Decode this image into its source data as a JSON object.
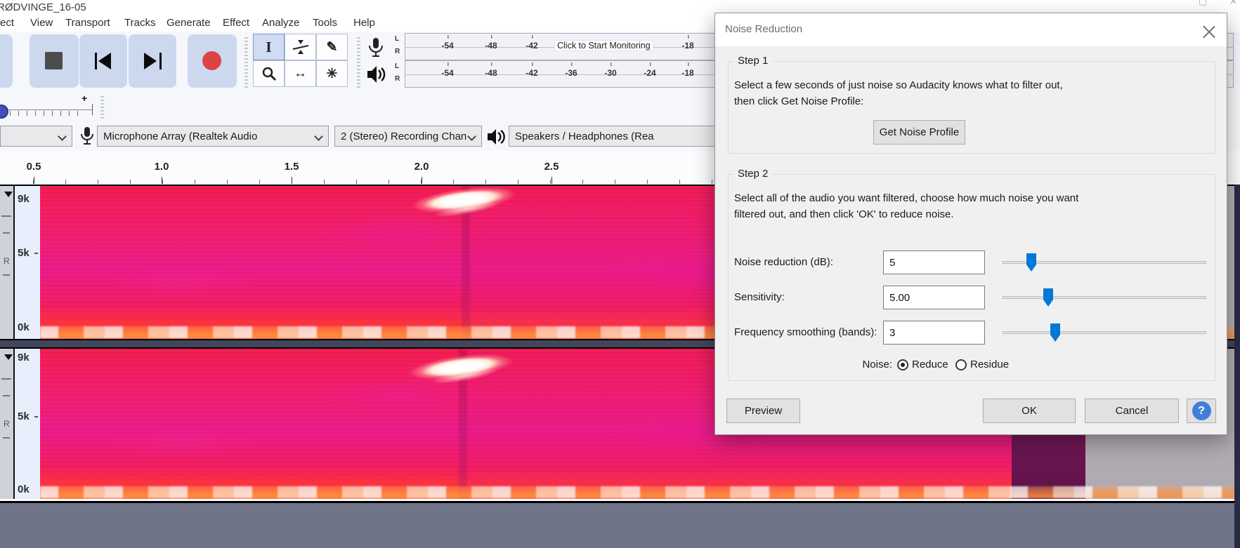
{
  "window": {
    "title": "RØDVINGE_16-05"
  },
  "menu": {
    "items": [
      "ect",
      "View",
      "Transport",
      "Tracks",
      "Generate",
      "Effect",
      "Analyze",
      "Tools",
      "Help"
    ]
  },
  "icon_glyphs": {
    "selection_tool": "I",
    "draw_tool": "✎",
    "timeshift_tool": "↔",
    "multi_tool": "✳",
    "volume_plus": "+"
  },
  "meters": {
    "record": {
      "channel_labels": [
        "L",
        "R"
      ],
      "ticks": [
        "-54",
        "-48",
        "-42"
      ],
      "monitor_text": "Click to Start Monitoring",
      "tick_end": "-18"
    },
    "playback": {
      "channel_labels": [
        "L",
        "R"
      ],
      "ticks": [
        "-54",
        "-48",
        "-42",
        "-36",
        "-30",
        "-24",
        "-18"
      ]
    }
  },
  "devices": {
    "host_value": "",
    "input_value": "Microphone Array (Realtek Audio",
    "channels_value": "2 (Stereo) Recording Chan",
    "output_value": "Speakers / Headphones (Rea"
  },
  "timeline": {
    "ticks": [
      "0.5",
      "1.0",
      "1.5",
      "2.0",
      "2.5"
    ]
  },
  "tracks": {
    "freq_labels": [
      "9k",
      "5k",
      "0k"
    ],
    "control_fragment": "R"
  },
  "dialog": {
    "title": "Noise Reduction",
    "step1": {
      "label": "Step 1",
      "line1": "Select a few seconds of just noise so Audacity knows what to filter out,",
      "line2": "then click Get Noise Profile:",
      "button": "Get Noise Profile"
    },
    "step2": {
      "label": "Step 2",
      "line1": "Select all of the audio you want filtered, choose how much noise you want",
      "line2": "filtered out, and then click 'OK' to reduce noise.",
      "rows": [
        {
          "label": "Noise reduction (dB):",
          "value": "5"
        },
        {
          "label": "Sensitivity:",
          "value": "5.00"
        },
        {
          "label": "Frequency smoothing (bands):",
          "value": "3"
        }
      ],
      "noise_label": "Noise:",
      "radio_options": [
        {
          "label": "Reduce",
          "selected": true
        },
        {
          "label": "Residue",
          "selected": false
        }
      ]
    },
    "buttons": {
      "preview": "Preview",
      "ok": "OK",
      "cancel": "Cancel",
      "help": "?"
    }
  },
  "colors": {
    "accent": "#0078d7",
    "record_red": "#dd4343",
    "play_green": "#63bf6a",
    "spectrogram_red": "#f01a4e",
    "spectrogram_magenta": "#e81a8c",
    "tool_selected": "#cfdcf3"
  }
}
